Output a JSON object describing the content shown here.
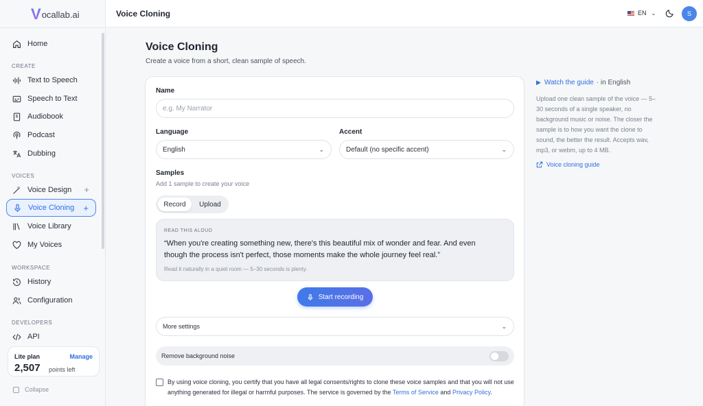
{
  "app": {
    "logo_letter": "V",
    "logo_text": "ocallab.ai"
  },
  "topbar": {
    "title": "Voice Cloning",
    "language": "EN",
    "avatar_initial": "S"
  },
  "sidebar": {
    "home": "Home",
    "sections": {
      "create": "CREATE",
      "voices": "VOICES",
      "workspace": "WORKSPACE",
      "developers": "DEVELOPERS"
    },
    "items": {
      "tts": "Text to Speech",
      "stt": "Speech to Text",
      "audiobook": "Audiobook",
      "podcast": "Podcast",
      "dubbing": "Dubbing",
      "voice_design": "Voice Design",
      "voice_cloning": "Voice Cloning",
      "voice_library": "Voice Library",
      "my_voices": "My Voices",
      "history": "History",
      "configuration": "Configuration",
      "api": "API"
    },
    "plan": {
      "name": "Lite plan",
      "manage": "Manage",
      "points": "2,507",
      "points_label": "points left"
    },
    "collapse": "Collapse"
  },
  "main": {
    "title": "Voice Cloning",
    "subtitle": "Create a voice from a short, clean sample of speech.",
    "name_label": "Name",
    "name_placeholder": "e.g. My Narrator",
    "language_label": "Language",
    "language_value": "English",
    "accent_label": "Accent",
    "accent_value": "Default (no specific accent)",
    "samples_label": "Samples",
    "samples_hint": "Add 1 sample to create your voice",
    "tab_record": "Record",
    "tab_upload": "Upload",
    "read_label": "READ THIS ALOUD",
    "read_text": "“When you're creating something new, there's this beautiful mix of wonder and fear. And even though the process isn't perfect, those moments make the whole journey feel real.”",
    "read_hint": "Read it naturally in a quiet room — 5–30 seconds is plenty.",
    "record_button": "Start recording",
    "more_settings": "More settings",
    "noise_label": "Remove background noise",
    "consent_text": "By using voice cloning, you certify that you have all legal consents/rights to clone these voice samples and that you will not use anything generated for illegal or harmful purposes. The service is governed by the",
    "terms_link": "Terms of Service",
    "consent_and": "and",
    "privacy_link": "Privacy Policy",
    "consent_end": "."
  },
  "guide": {
    "watch_label": "Watch the guide",
    "watch_suffix": "· in English",
    "text": "Upload one clean sample of the voice — 5–30 seconds of a single speaker, no background music or noise. The closer the sample is to how you want the clone to sound, the better the result. Accepts wav, mp3, or webm, up to 4 MB.",
    "link": "Voice cloning guide"
  },
  "colors": {
    "accent": "#2f6fe0",
    "active_bg": "#eaf1fe",
    "avatar": "#4a86ea"
  },
  "icons": [
    "home-icon",
    "waveform-icon",
    "caption-icon",
    "book-icon",
    "podcast-icon",
    "translate-icon",
    "wand-icon",
    "mic-icon",
    "library-icon",
    "heart-icon",
    "history-icon",
    "users-icon",
    "code-icon",
    "moon-icon",
    "play-icon",
    "external-link-icon",
    "chevron-down-icon",
    "plus-icon"
  ]
}
